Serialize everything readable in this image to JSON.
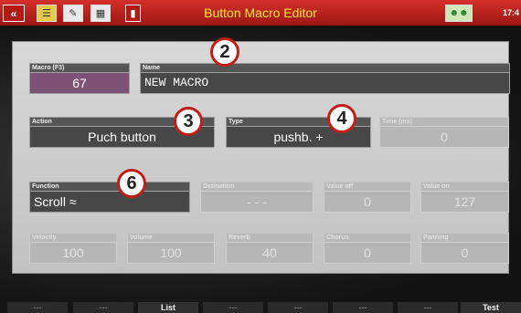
{
  "topbar": {
    "title": "Button Macro Editor",
    "clock": "17:4",
    "icons": [
      "back-icon",
      "menu-icon",
      "edit-icon",
      "mixer-icon",
      "trash-icon",
      "people-icon"
    ]
  },
  "fields": {
    "macro": {
      "label": "Macro (F3)",
      "value": "67"
    },
    "name": {
      "label": "Name",
      "value": "NEW MACRO"
    },
    "action": {
      "label": "Action",
      "value": "Puch button"
    },
    "type": {
      "label": "Type",
      "value": "pushb. +"
    },
    "time": {
      "label": "Time (ms)",
      "value": "0"
    },
    "function": {
      "label": "Function",
      "value": "Scroll ≈"
    },
    "destination": {
      "label": "Dstination",
      "value": "- - -"
    },
    "value_off": {
      "label": "Value off",
      "value": "0"
    },
    "value_on": {
      "label": "Value on",
      "value": "127"
    },
    "velocity": {
      "label": "Velocity",
      "value": "100"
    },
    "volume": {
      "label": "Volume",
      "value": "100"
    },
    "reverb": {
      "label": "Reverb",
      "value": "40"
    },
    "chorus": {
      "label": "Chorus",
      "value": "0"
    },
    "panning": {
      "label": "Panning",
      "value": "0"
    }
  },
  "badges": {
    "b2": "2",
    "b3": "3",
    "b4": "4",
    "b6": "6"
  },
  "softkeys": [
    "---",
    "---",
    "List",
    "---",
    "---",
    "---",
    "---",
    "Test"
  ],
  "colors": {
    "accent_red": "#c11e17",
    "title_yellow": "#ffe633",
    "macro_purple": "#7e5277"
  }
}
